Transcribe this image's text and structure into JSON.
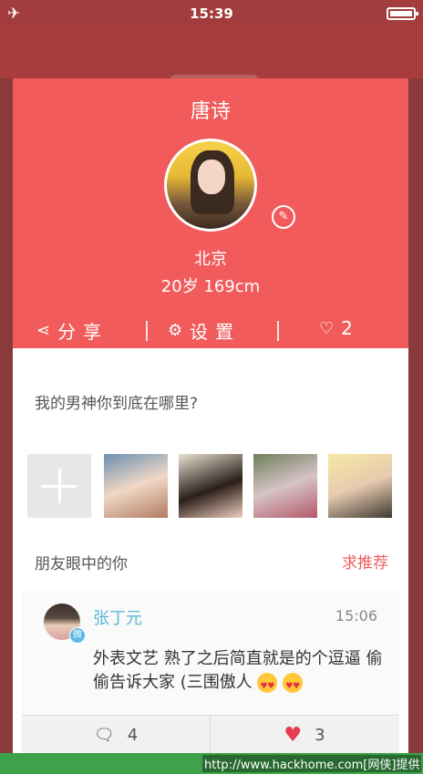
{
  "status": {
    "time": "15:39",
    "airplane_icon": "airplane-icon",
    "battery_level": 1.0
  },
  "profile": {
    "name": "唐诗",
    "city": "北京",
    "stats": "20岁  169cm",
    "share_label": "分享",
    "settings_label": "设置",
    "likes": "2",
    "background_color": "#f15b5b"
  },
  "motto": "我的男神你到底在哪里?",
  "photos": [
    "photo-1",
    "photo-2",
    "photo-3",
    "photo-4"
  ],
  "friends": {
    "title": "朋友眼中的你",
    "recommend_label": "求推荐"
  },
  "comment": {
    "author": "张丁元",
    "time": "15:06",
    "text": "外表文艺 熟了之后简直就是的个逗逼 偷偷告诉大家 (三围傲人",
    "comment_count": "4",
    "like_count": "3"
  },
  "watermark": "http://www.hackhome.com[网侠]提供"
}
